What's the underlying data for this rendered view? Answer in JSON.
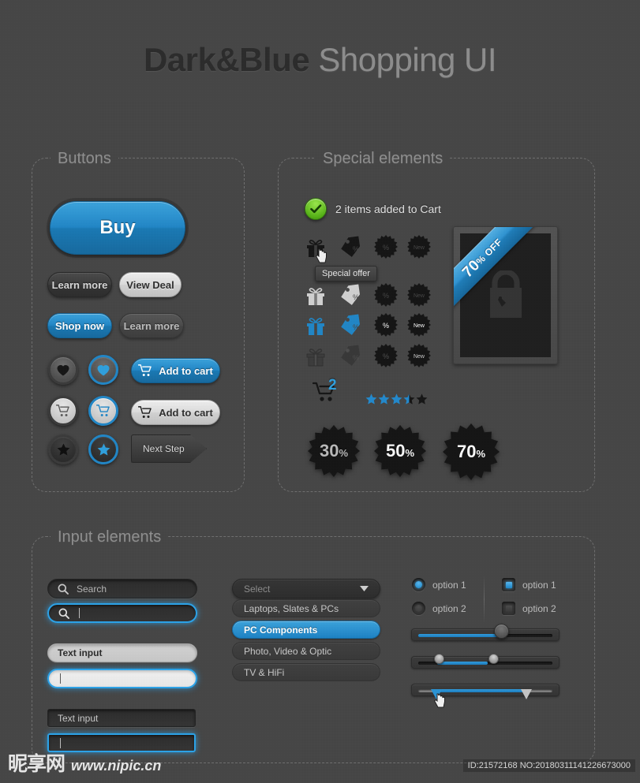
{
  "header": {
    "title_bold": "Dark&Blue",
    "title_light": "Shopping UI"
  },
  "panels": {
    "buttons_label": "Buttons",
    "special_label": "Special elements",
    "input_label": "Input elements"
  },
  "buttons": {
    "buy": "Buy",
    "learn_more_dark": "Learn more",
    "view_deal": "View Deal",
    "shop_now": "Shop now",
    "learn_more_grey": "Learn more",
    "add_to_cart_blue": "Add to cart",
    "add_to_cart_light": "Add to cart",
    "next_step": "Next Step",
    "icons": {
      "heart": "heart-icon",
      "heart_selected": "heart-icon",
      "cart": "cart-icon",
      "cart_selected": "cart-icon",
      "star": "star-icon",
      "star_selected": "star-icon"
    }
  },
  "special": {
    "cart_message": "2 items added to Cart",
    "check_icon": "check-icon",
    "tooltip": "Special offer",
    "icon_columns": [
      "gift-icon",
      "price-tag-percent-icon",
      "starburst-percent-icon",
      "starburst-new-icon"
    ],
    "icon_rows": [
      "black",
      "silver",
      "blue",
      "embossed"
    ],
    "starburst_new_label": "New",
    "starburst_percent_label": "%",
    "cart_count": "2",
    "rating": {
      "value": 3.5,
      "max": 5
    },
    "product": {
      "ribbon_value": "70",
      "ribbon_pct": "%",
      "ribbon_off": "OFF",
      "icon": "shopping-bag-icon"
    },
    "discount_badges": [
      {
        "value": "30",
        "pct": "%",
        "style": "grey"
      },
      {
        "value": "50",
        "pct": "%",
        "style": "dark"
      },
      {
        "value": "70",
        "pct": "%",
        "style": "blue"
      }
    ]
  },
  "inputs": {
    "search_placeholder": "Search",
    "search_icon": "search-icon",
    "search_focus_value": "",
    "text_input_light": "Text input",
    "text_input_light_focus_value": "",
    "text_input_dark": "Text input",
    "text_input_dark_focus_value": "",
    "dropdown": {
      "selected_label": "Select",
      "chevron": "chevron-down-icon",
      "options": [
        {
          "label": "Laptops, Slates & PCs",
          "selected": false
        },
        {
          "label": "PC Components",
          "selected": true
        },
        {
          "label": "Photo, Video & Optic",
          "selected": false
        },
        {
          "label": "TV & HiFi",
          "selected": false
        }
      ]
    },
    "radios": [
      {
        "label": "option 1",
        "checked": true
      },
      {
        "label": "option 2",
        "checked": false
      }
    ],
    "checkboxes": [
      {
        "label": "option 1",
        "checked": true
      },
      {
        "label": "option 2",
        "checked": false
      }
    ],
    "sliders": [
      {
        "type": "single",
        "value": 62
      },
      {
        "type": "range",
        "from": 14,
        "to": 52
      },
      {
        "type": "range-markers",
        "from": 14,
        "to": 80
      }
    ]
  },
  "footer": {
    "site_cn": "昵享网",
    "site_url": "www.nipic.cn",
    "id_text": "ID:21572168 NO:20180311141226673000"
  },
  "colors": {
    "accent_blue": "#1f86c6",
    "background": "#454545",
    "green": "#55b215"
  }
}
